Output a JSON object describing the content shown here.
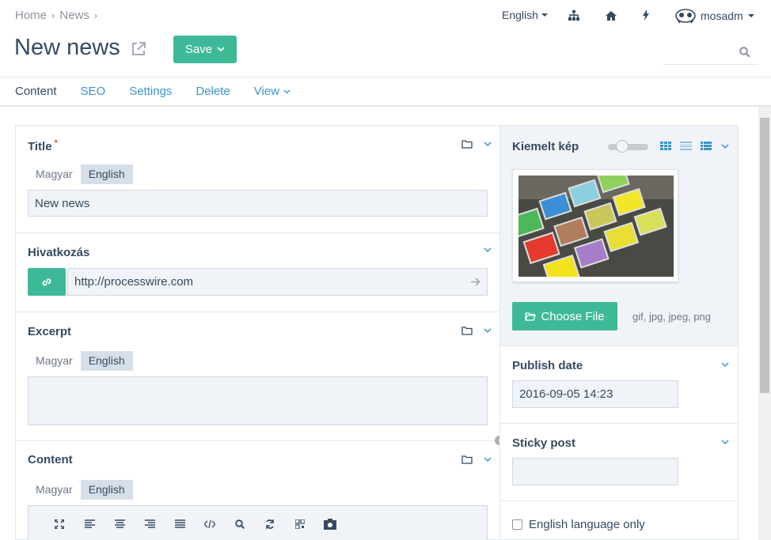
{
  "breadcrumb": {
    "home": "Home",
    "news": "News"
  },
  "page": {
    "title": "New news",
    "save_label": "Save"
  },
  "topnav": {
    "language": "English",
    "user": "mosadm"
  },
  "search": {
    "placeholder": ""
  },
  "tabs": [
    {
      "label": "Content"
    },
    {
      "label": "SEO"
    },
    {
      "label": "Settings"
    },
    {
      "label": "Delete"
    },
    {
      "label": "View"
    }
  ],
  "languages": {
    "magyar": "Magyar",
    "english": "English"
  },
  "fields": {
    "title": {
      "label": "Title",
      "required_mark": "*",
      "value": "New news"
    },
    "link": {
      "label": "Hivatkozás",
      "value": "http://processwire.com"
    },
    "excerpt": {
      "label": "Excerpt",
      "value": ""
    },
    "content": {
      "label": "Content"
    }
  },
  "sidebar": {
    "image": {
      "label": "Kiemelt kép",
      "choose_label": "Choose File",
      "extensions": "gif, jpg, jpeg, png"
    },
    "publish_date": {
      "label": "Publish date",
      "value": "2016-09-05 14:23"
    },
    "sticky": {
      "label": "Sticky post",
      "value": ""
    },
    "english_only": {
      "label": "English language only",
      "checked": false
    }
  },
  "colors": {
    "accent": "#3eb998",
    "link": "#3a95c9",
    "text": "#354b60"
  },
  "icons": [
    "external-link-icon",
    "sitemap-icon",
    "home-icon",
    "bolt-icon",
    "folder-icon",
    "chevron-down-icon",
    "link-icon",
    "arrow-right-icon",
    "search-icon",
    "grid-icon",
    "list-icon",
    "upload-icon",
    "info-icon",
    "fullscreen-icon",
    "align-left-icon",
    "align-center-icon",
    "align-right-icon",
    "align-justify-icon",
    "source-icon",
    "find-icon",
    "replace-icon",
    "template-icon",
    "image-icon"
  ]
}
